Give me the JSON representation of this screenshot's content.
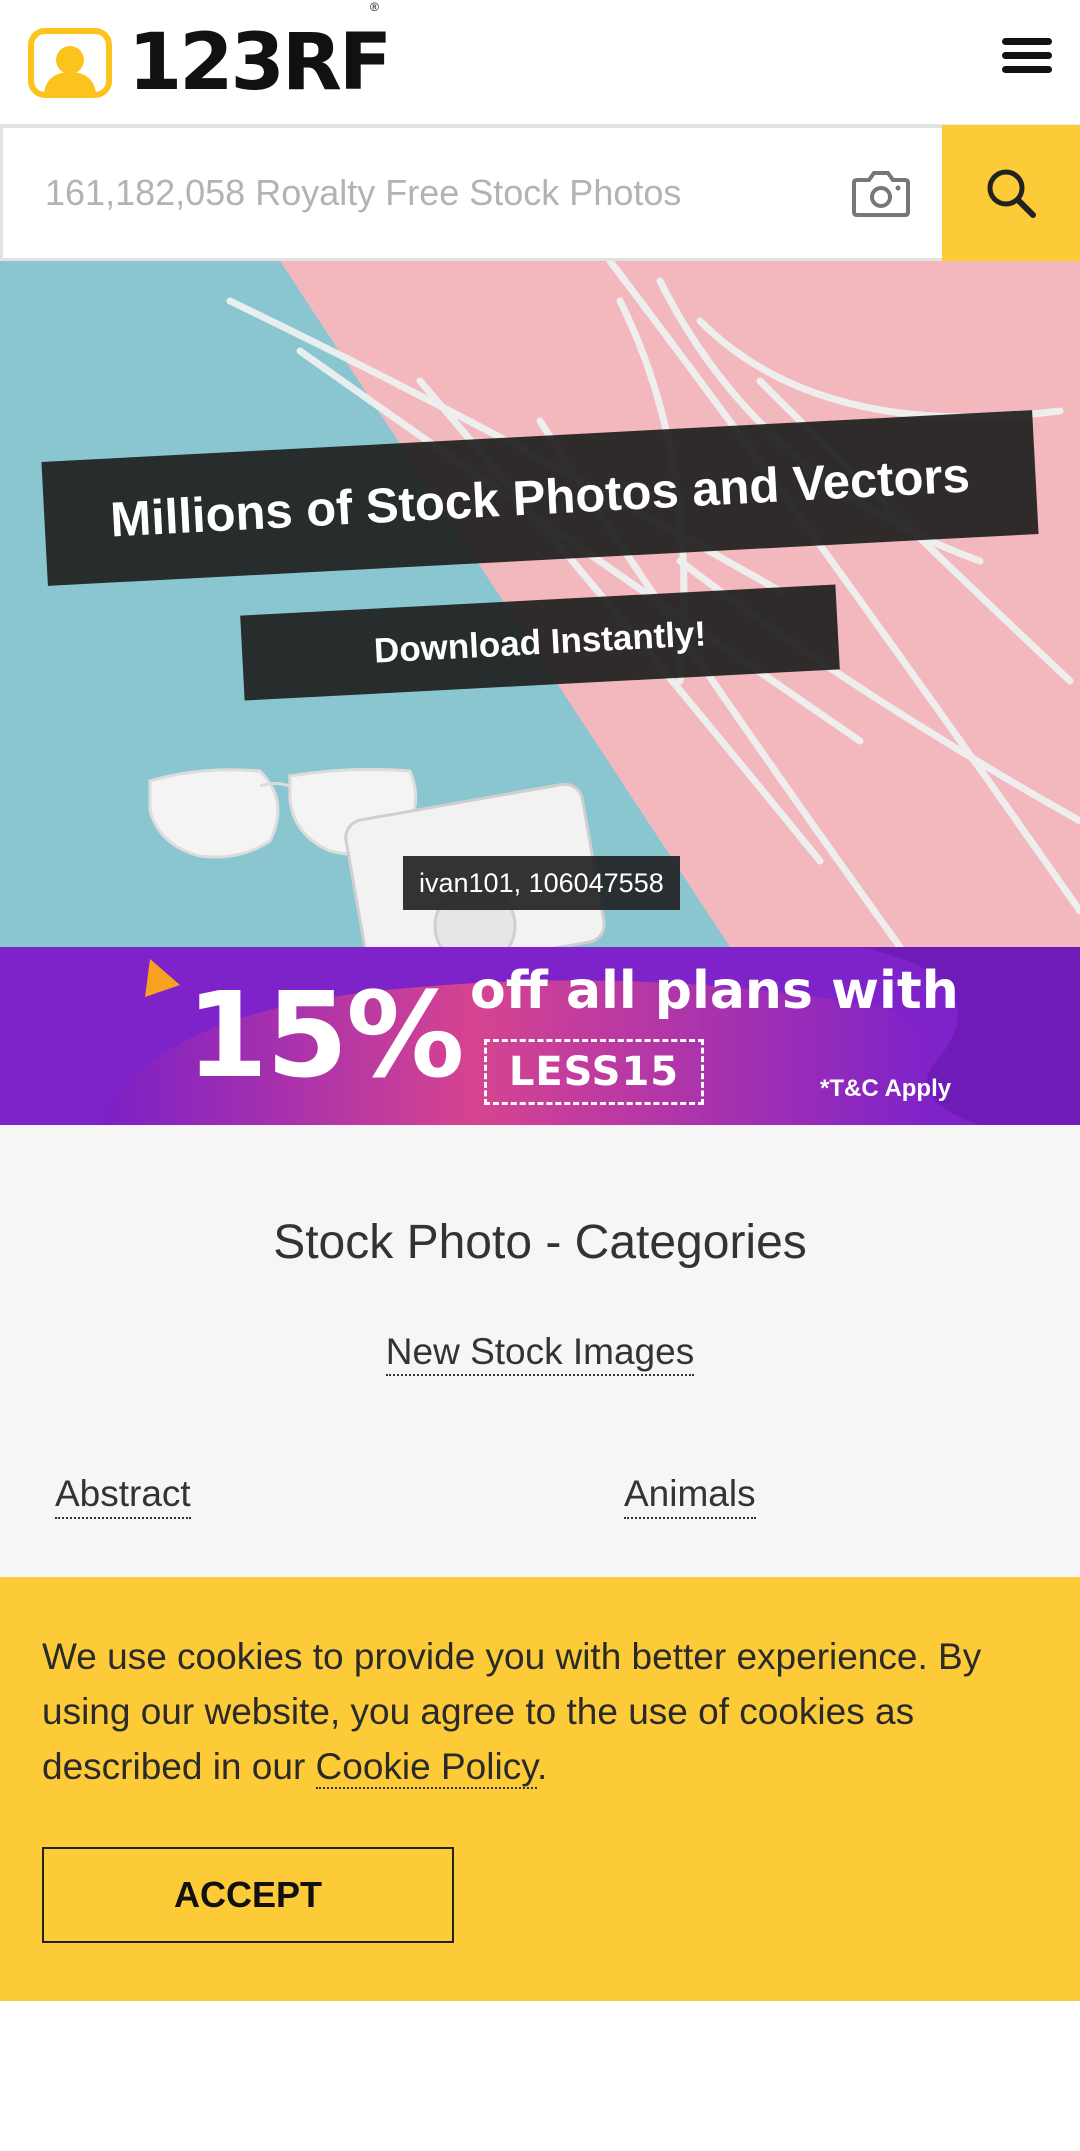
{
  "header": {
    "logo_text": "123RF",
    "logo_reg": "®",
    "menu_icon": "hamburger-menu-icon"
  },
  "search": {
    "placeholder": "161,182,058 Royalty Free Stock Photos",
    "camera_icon": "camera-icon",
    "search_icon": "search-icon",
    "button_color": "#fccb37"
  },
  "hero": {
    "headline": "Millions of Stock Photos and Vectors",
    "subline": "Download Instantly!",
    "credit": "ivan101, 106047558"
  },
  "promo": {
    "percent": "15%",
    "line": "off all plans with",
    "code": "LESS15",
    "terms": "*T&C Apply"
  },
  "categories": {
    "title": "Stock Photo - Categories",
    "new_link": "New Stock Images",
    "items": [
      "Abstract",
      "Animals"
    ]
  },
  "cookie": {
    "text_before": "We use cookies to provide you with better experience. By using our website, you agree to the use of cookies as described in our ",
    "link": "Cookie Policy",
    "text_after": ".",
    "accept": "ACCEPT",
    "bg_color": "#fccb37"
  }
}
